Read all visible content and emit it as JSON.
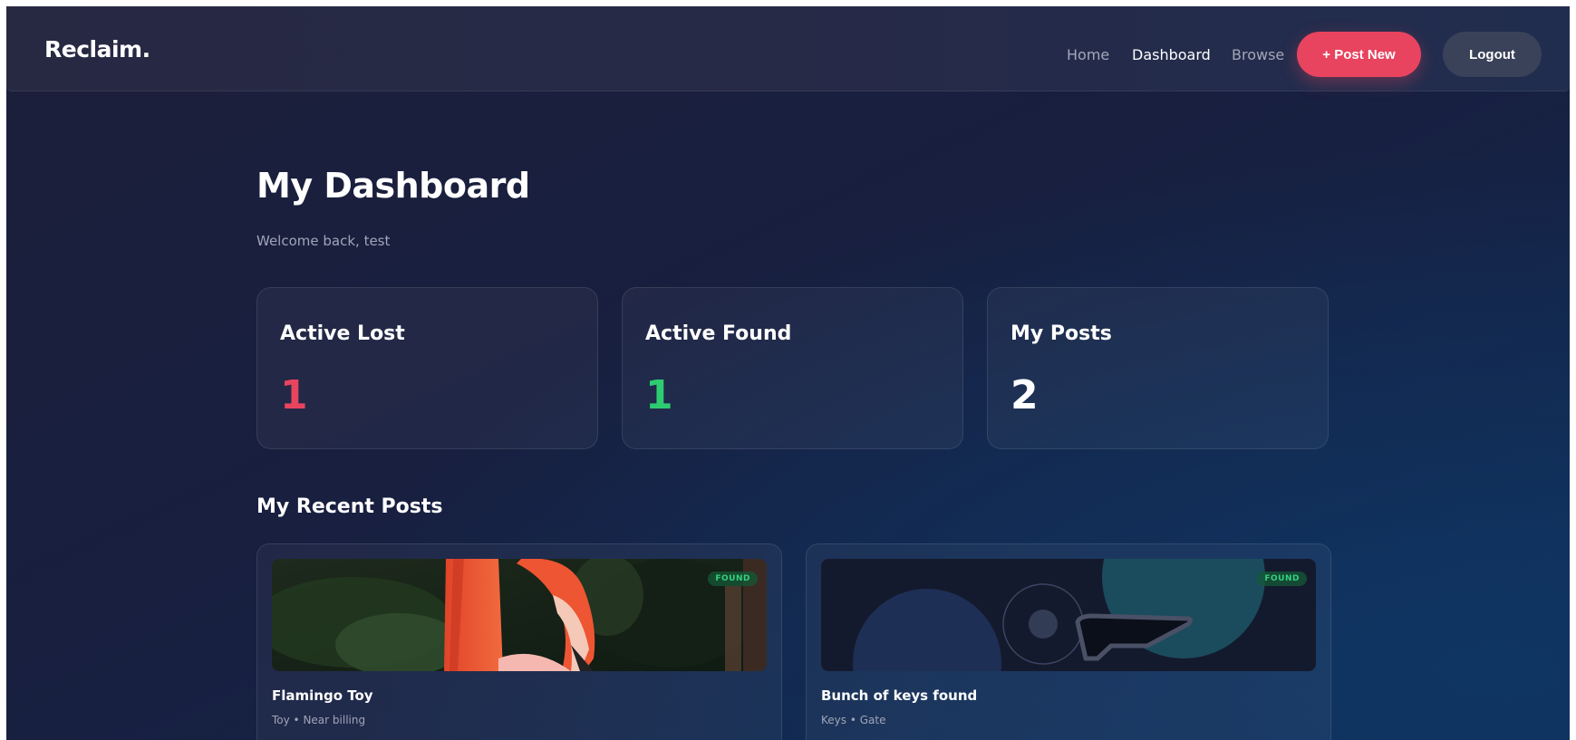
{
  "navbar": {
    "brand": "Reclaim.",
    "links": [
      {
        "label": "Home",
        "active": false
      },
      {
        "label": "Dashboard",
        "active": true
      },
      {
        "label": "Browse",
        "active": false
      }
    ],
    "post_new_label": "+ Post New",
    "logout_label": "Logout"
  },
  "header": {
    "title": "My Dashboard",
    "welcome": "Welcome back, test"
  },
  "stats": [
    {
      "label": "Active Lost",
      "value": "1",
      "color": "#e8445f"
    },
    {
      "label": "Active Found",
      "value": "1",
      "color": "#2ecc71"
    },
    {
      "label": "My Posts",
      "value": "2",
      "color": "#ffffff"
    }
  ],
  "recent": {
    "title": "My Recent Posts",
    "posts": [
      {
        "title": "Flamingo Toy",
        "meta": "Toy • Near billing",
        "badge": "FOUND",
        "image": "flamingo-photo"
      },
      {
        "title": "Bunch of keys found",
        "meta": "Keys • Gate",
        "badge": "FOUND",
        "image": "keys-illustration"
      }
    ]
  },
  "colors": {
    "accent": "#e8445f",
    "found": "#35d07f"
  }
}
